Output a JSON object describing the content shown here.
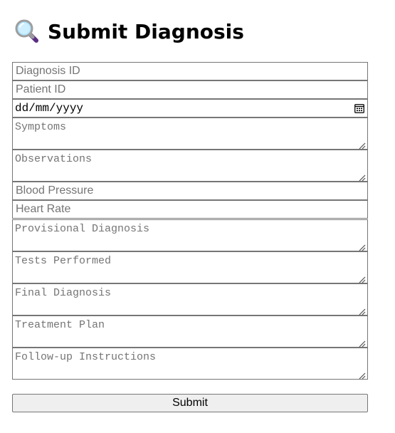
{
  "header": {
    "title": "Submit Diagnosis",
    "icon": "magnifying-glass-icon"
  },
  "form": {
    "diagnosis_id_placeholder": "Diagnosis ID",
    "patient_id_placeholder": "Patient ID",
    "date_value": "dd/mm/yyyy",
    "symptoms_placeholder": "Symptoms",
    "observations_placeholder": "Observations",
    "blood_pressure_placeholder": "Blood Pressure",
    "heart_rate_placeholder": "Heart Rate",
    "provisional_diagnosis_placeholder": "Provisional Diagnosis",
    "tests_performed_placeholder": "Tests Performed",
    "final_diagnosis_placeholder": "Final Diagnosis",
    "treatment_plan_placeholder": "Treatment Plan",
    "follow_up_placeholder": "Follow-up Instructions",
    "submit_label": "Submit"
  },
  "colors": {
    "border": "#767676",
    "placeholder": "#757575",
    "button_bg": "#efefef"
  }
}
